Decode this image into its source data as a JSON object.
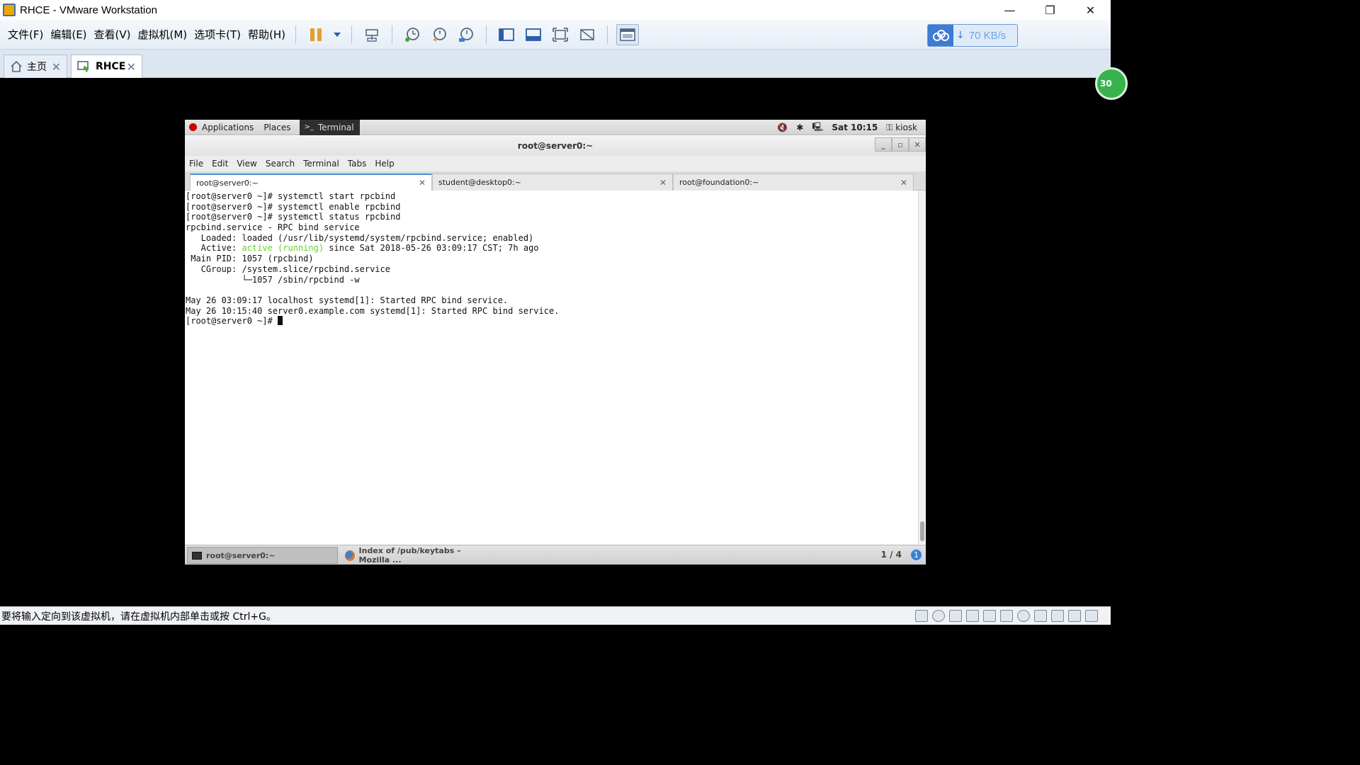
{
  "window": {
    "title": "RHCE - VMware Workstation",
    "controls": [
      "—",
      "❐",
      "✕"
    ]
  },
  "menu": [
    {
      "label": "文件(F)"
    },
    {
      "label": "编辑(E)"
    },
    {
      "label": "查看(V)"
    },
    {
      "label": "虚拟机(M)"
    },
    {
      "label": "选项卡(T)"
    },
    {
      "label": "帮助(H)"
    }
  ],
  "network": {
    "speed": "70 KB/s"
  },
  "vm_tabs": [
    {
      "label": "主页",
      "close": "✕"
    },
    {
      "label": "RHCE",
      "close": "✕"
    }
  ],
  "side_badge": "30",
  "guest": {
    "top_panel": {
      "applications": "Applications",
      "places": "Places",
      "terminal": "Terminal",
      "clock": "Sat 10:15",
      "user": "kiosk"
    },
    "terminal_window": {
      "title": "root@server0:~",
      "buttons": [
        "_",
        "▫",
        "✕"
      ],
      "menu": [
        "File",
        "Edit",
        "View",
        "Search",
        "Terminal",
        "Tabs",
        "Help"
      ],
      "tabs": [
        {
          "label": "root@server0:~",
          "close": "✕"
        },
        {
          "label": "student@desktop0:~",
          "close": "✕"
        },
        {
          "label": "root@foundation0:~",
          "close": "✕"
        }
      ],
      "lines": {
        "l1": "[root@server0 ~]# systemctl start rpcbind",
        "l2": "[root@server0 ~]# systemctl enable rpcbind",
        "l3": "[root@server0 ~]# systemctl status rpcbind",
        "l4": "rpcbind.service - RPC bind service",
        "l5": "   Loaded: loaded (/usr/lib/systemd/system/rpcbind.service; enabled)",
        "l6_a": "   Active: ",
        "l6_b": "active (running)",
        "l6_c": " since Sat 2018-05-26 03:09:17 CST; 7h ago",
        "l7": " Main PID: 1057 (rpcbind)",
        "l8": "   CGroup: /system.slice/rpcbind.service",
        "l9": "           └─1057 /sbin/rpcbind -w",
        "l10": "",
        "l11": "May 26 03:09:17 localhost systemd[1]: Started RPC bind service.",
        "l12": "May 26 10:15:40 server0.example.com systemd[1]: Started RPC bind service.",
        "l13": "[root@server0 ~]# "
      }
    },
    "bottom_panel": {
      "tasks": [
        {
          "label": "root@server0:~"
        },
        {
          "label": "Index of /pub/keytabs – Mozilla ..."
        }
      ],
      "workspace": "1 / 4",
      "info": "1"
    }
  },
  "status_bar": {
    "text": "要将输入定向到该虚拟机，请在虚拟机内部单击或按 Ctrl+G。"
  }
}
